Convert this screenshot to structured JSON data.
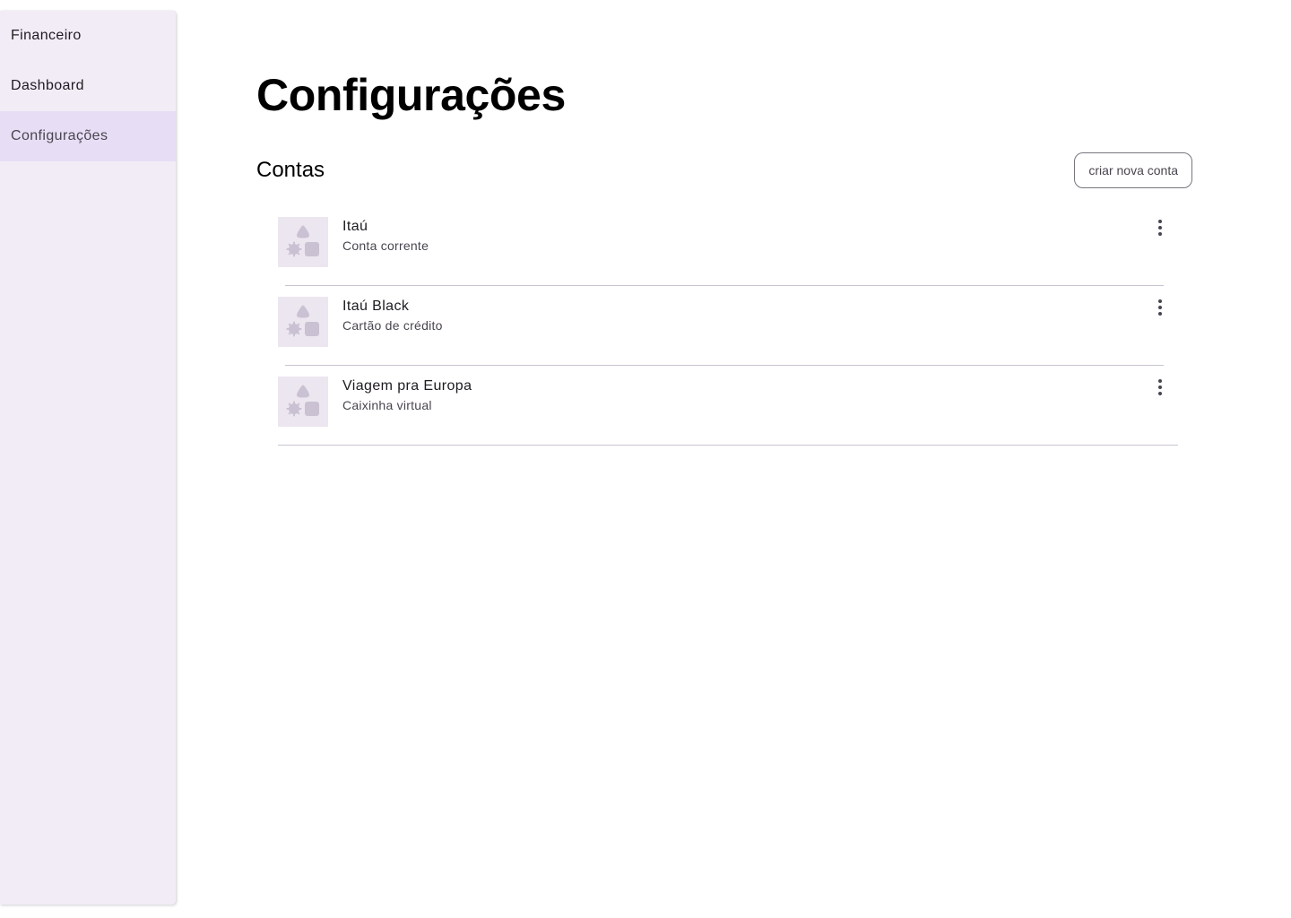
{
  "sidebar": {
    "items": [
      {
        "label": "Financeiro"
      },
      {
        "label": "Dashboard"
      },
      {
        "label": "Configurações"
      }
    ]
  },
  "main": {
    "title": "Configurações",
    "section_title": "Contas",
    "create_button_label": "criar nova conta",
    "accounts": [
      {
        "name": "Itaú",
        "type": "Conta corrente"
      },
      {
        "name": "Itaú Black",
        "type": "Cartão de crédito"
      },
      {
        "name": "Viagem pra Europa",
        "type": "Caixinha virtual"
      }
    ]
  },
  "colors": {
    "sidebar_bg": "#f2ecf7",
    "active_item_bg": "#e7def5",
    "thumbnail_bg": "#ece6f0",
    "divider": "#cac4d0"
  },
  "icons": {
    "thumbnail": "shapes-placeholder-icon",
    "more": "more-vert-icon"
  }
}
